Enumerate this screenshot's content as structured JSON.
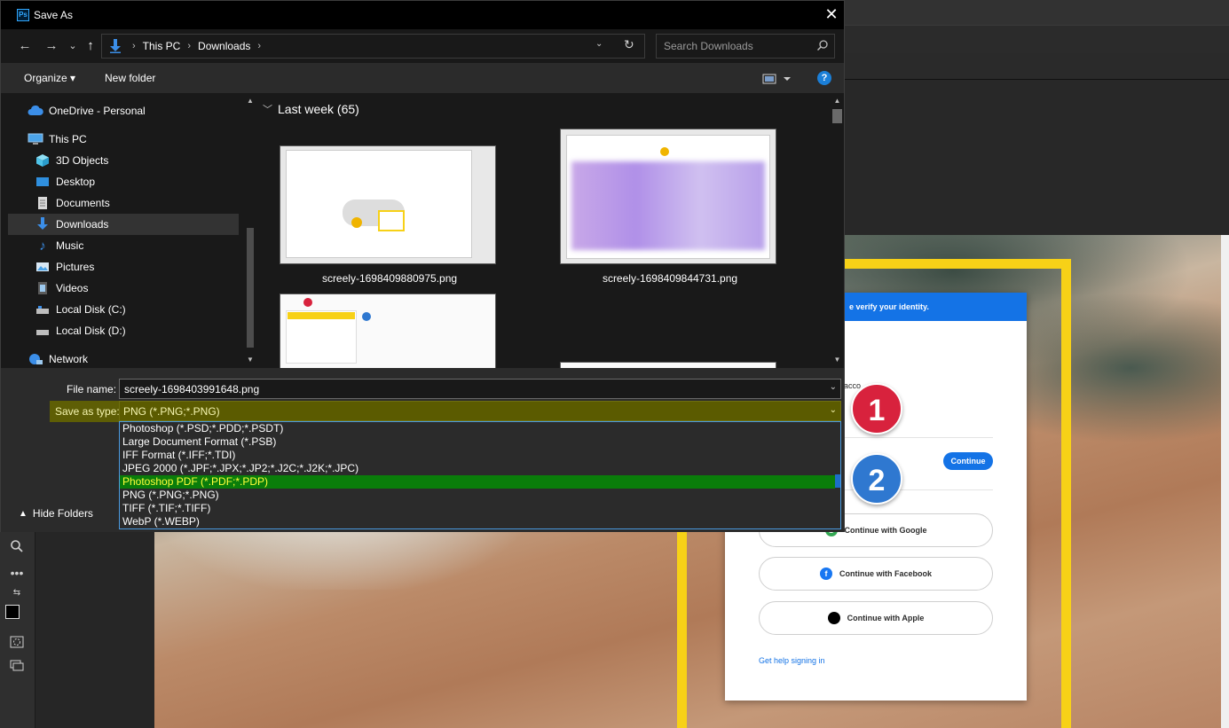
{
  "dialog": {
    "title": "Save As",
    "close_glyph": "✕"
  },
  "navigation": {
    "back_glyph": "←",
    "forward_glyph": "→",
    "recent_glyph": "⌄",
    "up_glyph": "↑",
    "breadcrumbs": [
      "This PC",
      "Downloads"
    ],
    "search_placeholder": "Search Downloads"
  },
  "toolbar": {
    "organize_label": "Organize ▾",
    "new_folder_label": "New folder",
    "help_glyph": "?"
  },
  "nav_pane": {
    "items": [
      {
        "label": "OneDrive - Personal",
        "icon": "cloud-icon",
        "color": "#3b8ee8"
      },
      {
        "label": "This PC",
        "icon": "computer-icon",
        "color": "#4ba3e8"
      },
      {
        "label": "3D Objects",
        "icon": "cube-icon",
        "color": "#4fc3e8"
      },
      {
        "label": "Desktop",
        "icon": "desktop-icon",
        "color": "#2f8fde"
      },
      {
        "label": "Documents",
        "icon": "document-icon",
        "color": "#d8d8d8"
      },
      {
        "label": "Downloads",
        "icon": "download-icon",
        "color": "#3b8ee8"
      },
      {
        "label": "Music",
        "icon": "music-note-icon",
        "color": "#3b8ee8"
      },
      {
        "label": "Pictures",
        "icon": "picture-icon",
        "color": "#4ba3e8"
      },
      {
        "label": "Videos",
        "icon": "video-icon",
        "color": "#9a9a9a"
      },
      {
        "label": "Local Disk (C:)",
        "icon": "drive-icon",
        "color": "#bdbdbd"
      },
      {
        "label": "Local Disk (D:)",
        "icon": "drive-icon",
        "color": "#bdbdbd"
      },
      {
        "label": "Network",
        "icon": "network-icon",
        "color": "#3b8ee8"
      }
    ],
    "selected": "Downloads"
  },
  "content": {
    "group_title": "Last week (65)",
    "files": [
      {
        "name": "screely-1698409880975.png"
      },
      {
        "name": "screely-1698409844731.png"
      },
      {
        "name": ""
      },
      {
        "name": ""
      }
    ]
  },
  "form": {
    "file_name_label": "File name:",
    "file_name_value": "screely-1698403991648.png",
    "save_type_label": "Save as type:",
    "save_type_value": "PNG (*.PNG;*.PNG)",
    "type_options": [
      "Photoshop (*.PSD;*.PDD;*.PSDT)",
      "Large Document Format (*.PSB)",
      "IFF Format (*.IFF;*.TDI)",
      "JPEG 2000 (*.JPF;*.JPX;*.JP2;*.J2C;*.J2K;*.JPC)",
      "Photoshop PDF (*.PDF;*.PDP)",
      "PNG (*.PNG;*.PNG)",
      "TIFF (*.TIF;*.TIFF)",
      "WebP (*.WEBP)"
    ],
    "highlighted_option": "Photoshop PDF (*.PDF;*.PDP)",
    "hide_folders_label": "Hide Folders"
  },
  "background": {
    "banner_text": "e verify your identity.",
    "account_text": "acco",
    "continue_label": "Continue",
    "google_label": "Continue with Google",
    "facebook_label": "Continue with Facebook",
    "apple_label": "Continue with Apple",
    "help_label": "Get help signing in",
    "badge_1": "1",
    "badge_2": "2",
    "badge_1_color": "#d8223d",
    "badge_2_color": "#2f78d0"
  },
  "colors": {
    "highlight_green": "#0a7d0a",
    "highlight_text": "#ffff3a",
    "save_type_bg": "#5b5b00",
    "accent_blue": "#1473e6",
    "frame_yellow": "#f7d117"
  }
}
